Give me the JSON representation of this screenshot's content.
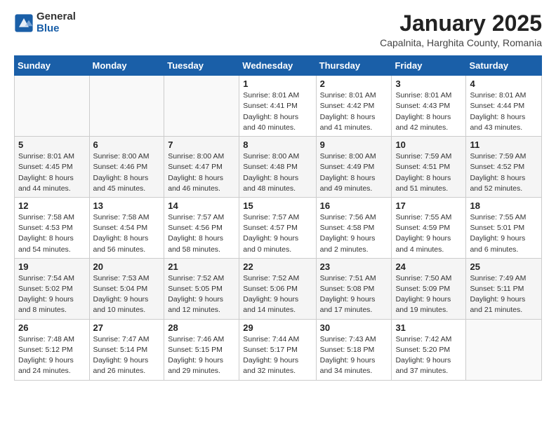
{
  "header": {
    "logo_general": "General",
    "logo_blue": "Blue",
    "month": "January 2025",
    "location": "Capalnita, Harghita County, Romania"
  },
  "weekdays": [
    "Sunday",
    "Monday",
    "Tuesday",
    "Wednesday",
    "Thursday",
    "Friday",
    "Saturday"
  ],
  "weeks": [
    [
      {
        "day": "",
        "info": ""
      },
      {
        "day": "",
        "info": ""
      },
      {
        "day": "",
        "info": ""
      },
      {
        "day": "1",
        "info": "Sunrise: 8:01 AM\nSunset: 4:41 PM\nDaylight: 8 hours\nand 40 minutes."
      },
      {
        "day": "2",
        "info": "Sunrise: 8:01 AM\nSunset: 4:42 PM\nDaylight: 8 hours\nand 41 minutes."
      },
      {
        "day": "3",
        "info": "Sunrise: 8:01 AM\nSunset: 4:43 PM\nDaylight: 8 hours\nand 42 minutes."
      },
      {
        "day": "4",
        "info": "Sunrise: 8:01 AM\nSunset: 4:44 PM\nDaylight: 8 hours\nand 43 minutes."
      }
    ],
    [
      {
        "day": "5",
        "info": "Sunrise: 8:01 AM\nSunset: 4:45 PM\nDaylight: 8 hours\nand 44 minutes."
      },
      {
        "day": "6",
        "info": "Sunrise: 8:00 AM\nSunset: 4:46 PM\nDaylight: 8 hours\nand 45 minutes."
      },
      {
        "day": "7",
        "info": "Sunrise: 8:00 AM\nSunset: 4:47 PM\nDaylight: 8 hours\nand 46 minutes."
      },
      {
        "day": "8",
        "info": "Sunrise: 8:00 AM\nSunset: 4:48 PM\nDaylight: 8 hours\nand 48 minutes."
      },
      {
        "day": "9",
        "info": "Sunrise: 8:00 AM\nSunset: 4:49 PM\nDaylight: 8 hours\nand 49 minutes."
      },
      {
        "day": "10",
        "info": "Sunrise: 7:59 AM\nSunset: 4:51 PM\nDaylight: 8 hours\nand 51 minutes."
      },
      {
        "day": "11",
        "info": "Sunrise: 7:59 AM\nSunset: 4:52 PM\nDaylight: 8 hours\nand 52 minutes."
      }
    ],
    [
      {
        "day": "12",
        "info": "Sunrise: 7:58 AM\nSunset: 4:53 PM\nDaylight: 8 hours\nand 54 minutes."
      },
      {
        "day": "13",
        "info": "Sunrise: 7:58 AM\nSunset: 4:54 PM\nDaylight: 8 hours\nand 56 minutes."
      },
      {
        "day": "14",
        "info": "Sunrise: 7:57 AM\nSunset: 4:56 PM\nDaylight: 8 hours\nand 58 minutes."
      },
      {
        "day": "15",
        "info": "Sunrise: 7:57 AM\nSunset: 4:57 PM\nDaylight: 9 hours\nand 0 minutes."
      },
      {
        "day": "16",
        "info": "Sunrise: 7:56 AM\nSunset: 4:58 PM\nDaylight: 9 hours\nand 2 minutes."
      },
      {
        "day": "17",
        "info": "Sunrise: 7:55 AM\nSunset: 4:59 PM\nDaylight: 9 hours\nand 4 minutes."
      },
      {
        "day": "18",
        "info": "Sunrise: 7:55 AM\nSunset: 5:01 PM\nDaylight: 9 hours\nand 6 minutes."
      }
    ],
    [
      {
        "day": "19",
        "info": "Sunrise: 7:54 AM\nSunset: 5:02 PM\nDaylight: 9 hours\nand 8 minutes."
      },
      {
        "day": "20",
        "info": "Sunrise: 7:53 AM\nSunset: 5:04 PM\nDaylight: 9 hours\nand 10 minutes."
      },
      {
        "day": "21",
        "info": "Sunrise: 7:52 AM\nSunset: 5:05 PM\nDaylight: 9 hours\nand 12 minutes."
      },
      {
        "day": "22",
        "info": "Sunrise: 7:52 AM\nSunset: 5:06 PM\nDaylight: 9 hours\nand 14 minutes."
      },
      {
        "day": "23",
        "info": "Sunrise: 7:51 AM\nSunset: 5:08 PM\nDaylight: 9 hours\nand 17 minutes."
      },
      {
        "day": "24",
        "info": "Sunrise: 7:50 AM\nSunset: 5:09 PM\nDaylight: 9 hours\nand 19 minutes."
      },
      {
        "day": "25",
        "info": "Sunrise: 7:49 AM\nSunset: 5:11 PM\nDaylight: 9 hours\nand 21 minutes."
      }
    ],
    [
      {
        "day": "26",
        "info": "Sunrise: 7:48 AM\nSunset: 5:12 PM\nDaylight: 9 hours\nand 24 minutes."
      },
      {
        "day": "27",
        "info": "Sunrise: 7:47 AM\nSunset: 5:14 PM\nDaylight: 9 hours\nand 26 minutes."
      },
      {
        "day": "28",
        "info": "Sunrise: 7:46 AM\nSunset: 5:15 PM\nDaylight: 9 hours\nand 29 minutes."
      },
      {
        "day": "29",
        "info": "Sunrise: 7:44 AM\nSunset: 5:17 PM\nDaylight: 9 hours\nand 32 minutes."
      },
      {
        "day": "30",
        "info": "Sunrise: 7:43 AM\nSunset: 5:18 PM\nDaylight: 9 hours\nand 34 minutes."
      },
      {
        "day": "31",
        "info": "Sunrise: 7:42 AM\nSunset: 5:20 PM\nDaylight: 9 hours\nand 37 minutes."
      },
      {
        "day": "",
        "info": ""
      }
    ]
  ]
}
